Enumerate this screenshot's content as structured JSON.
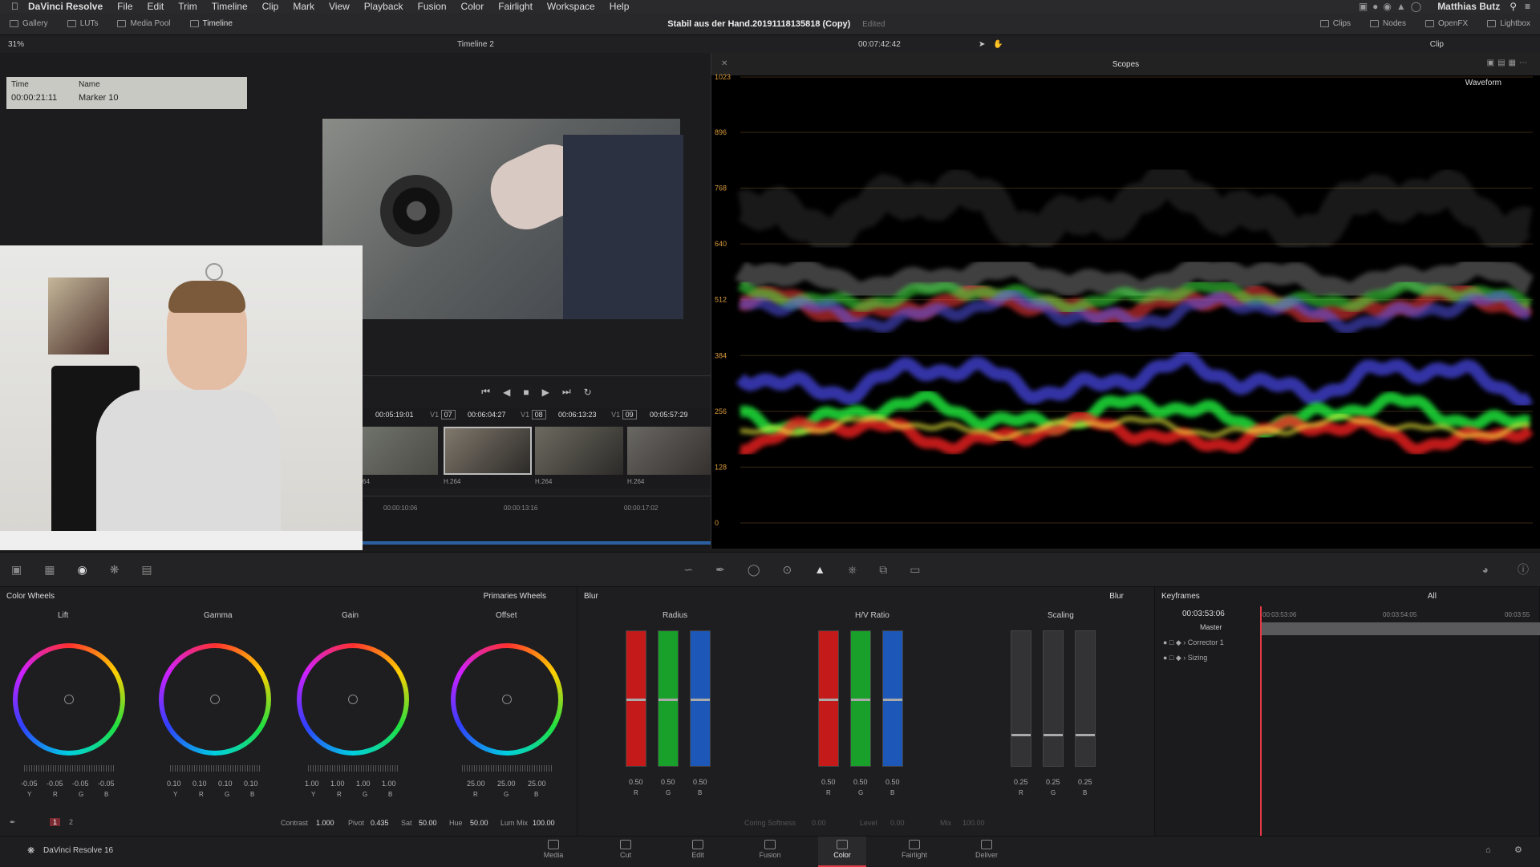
{
  "menubar": {
    "app": "DaVinci Resolve",
    "items": [
      "File",
      "Edit",
      "Trim",
      "Timeline",
      "Clip",
      "Mark",
      "View",
      "Playback",
      "Fusion",
      "Color",
      "Fairlight",
      "Workspace",
      "Help"
    ],
    "user": "Matthias Butz"
  },
  "toolbar": {
    "gallery": "Gallery",
    "luts": "LUTs",
    "media_pool": "Media Pool",
    "timeline": "Timeline",
    "project_title": "Stabil aus der Hand.20191118135818 (Copy)",
    "project_status": "Edited",
    "clips": "Clips",
    "nodes": "Nodes",
    "openfx": "OpenFX",
    "lightbox": "Lightbox"
  },
  "viewer": {
    "zoom": "31%",
    "timeline_name": "Timeline 2",
    "timecode": "00:07:42:42",
    "clip_mode": "Clip",
    "marker": {
      "time_label": "Time",
      "time": "00:00:21:11",
      "name_label": "Name",
      "name": "Marker 10"
    }
  },
  "clips": [
    {
      "tc": "00:05:19:01",
      "track": "V1",
      "num": "07",
      "codec": ""
    },
    {
      "tc": "00:06:04:27",
      "track": "V1",
      "num": "08",
      "codec": "H.264"
    },
    {
      "tc": "00:06:13:23",
      "track": "V1",
      "num": "09",
      "codec": "H.264"
    },
    {
      "tc": "00:05:57:29",
      "track": "V1",
      "num": "",
      "codec": "H.264"
    }
  ],
  "clip_first_codec": "64",
  "mini_timeline": [
    "00:00:10:06",
    "00:00:13:16",
    "00:00:17:02"
  ],
  "scopes": {
    "title": "Scopes",
    "mode": "Waveform",
    "y_ticks": [
      "1023",
      "896",
      "768",
      "640",
      "512",
      "384",
      "256",
      "128",
      "0"
    ]
  },
  "color_wheels": {
    "title": "Color Wheels",
    "mode": "Primaries Wheels",
    "wheels": [
      {
        "name": "Lift",
        "values": [
          "-0.05",
          "-0.05",
          "-0.05",
          "-0.05"
        ],
        "chans": [
          "Y",
          "R",
          "G",
          "B"
        ]
      },
      {
        "name": "Gamma",
        "values": [
          "0.10",
          "0.10",
          "0.10",
          "0.10"
        ],
        "chans": [
          "Y",
          "R",
          "G",
          "B"
        ]
      },
      {
        "name": "Gain",
        "values": [
          "1.00",
          "1.00",
          "1.00",
          "1.00"
        ],
        "chans": [
          "Y",
          "R",
          "G",
          "B"
        ]
      },
      {
        "name": "Offset",
        "values": [
          "25.00",
          "25.00",
          "25.00"
        ],
        "chans": [
          "R",
          "G",
          "B"
        ]
      }
    ],
    "page1": "1",
    "page2": "2",
    "contrast_label": "Contrast",
    "contrast": "1.000",
    "pivot_label": "Pivot",
    "pivot": "0.435",
    "sat_label": "Sat",
    "sat": "50.00",
    "hue_label": "Hue",
    "hue": "50.00",
    "lummix_label": "Lum Mix",
    "lummix": "100.00"
  },
  "blur": {
    "title": "Blur",
    "mode": "Blur",
    "groups": [
      {
        "name": "Radius",
        "values": [
          "0.50",
          "0.50",
          "0.50"
        ]
      },
      {
        "name": "H/V Ratio",
        "values": [
          "0.50",
          "0.50",
          "0.50"
        ]
      },
      {
        "name": "Scaling",
        "values": [
          "0.25",
          "0.25",
          "0.25"
        ]
      }
    ],
    "chans": [
      "R",
      "G",
      "B"
    ],
    "coring_label": "Coring Softness",
    "coring": "0.00",
    "level_label": "Level",
    "level": "0.00",
    "mix_label": "Mix",
    "mix": "100.00"
  },
  "keyframes": {
    "title": "Keyframes",
    "filter": "All",
    "current": "00:03:53:06",
    "ruler": [
      "00:03:53:06",
      "00:03:54:05",
      "00:03:55"
    ],
    "rows": [
      "Master",
      "Corrector 1",
      "Sizing"
    ]
  },
  "pages": [
    "Media",
    "Cut",
    "Edit",
    "Fusion",
    "Color",
    "Fairlight",
    "Deliver"
  ],
  "active_page": "Color",
  "footer_app": "DaVinci Resolve 16",
  "colors": {
    "accent": "#e63946",
    "panel": "#1e1e20"
  }
}
